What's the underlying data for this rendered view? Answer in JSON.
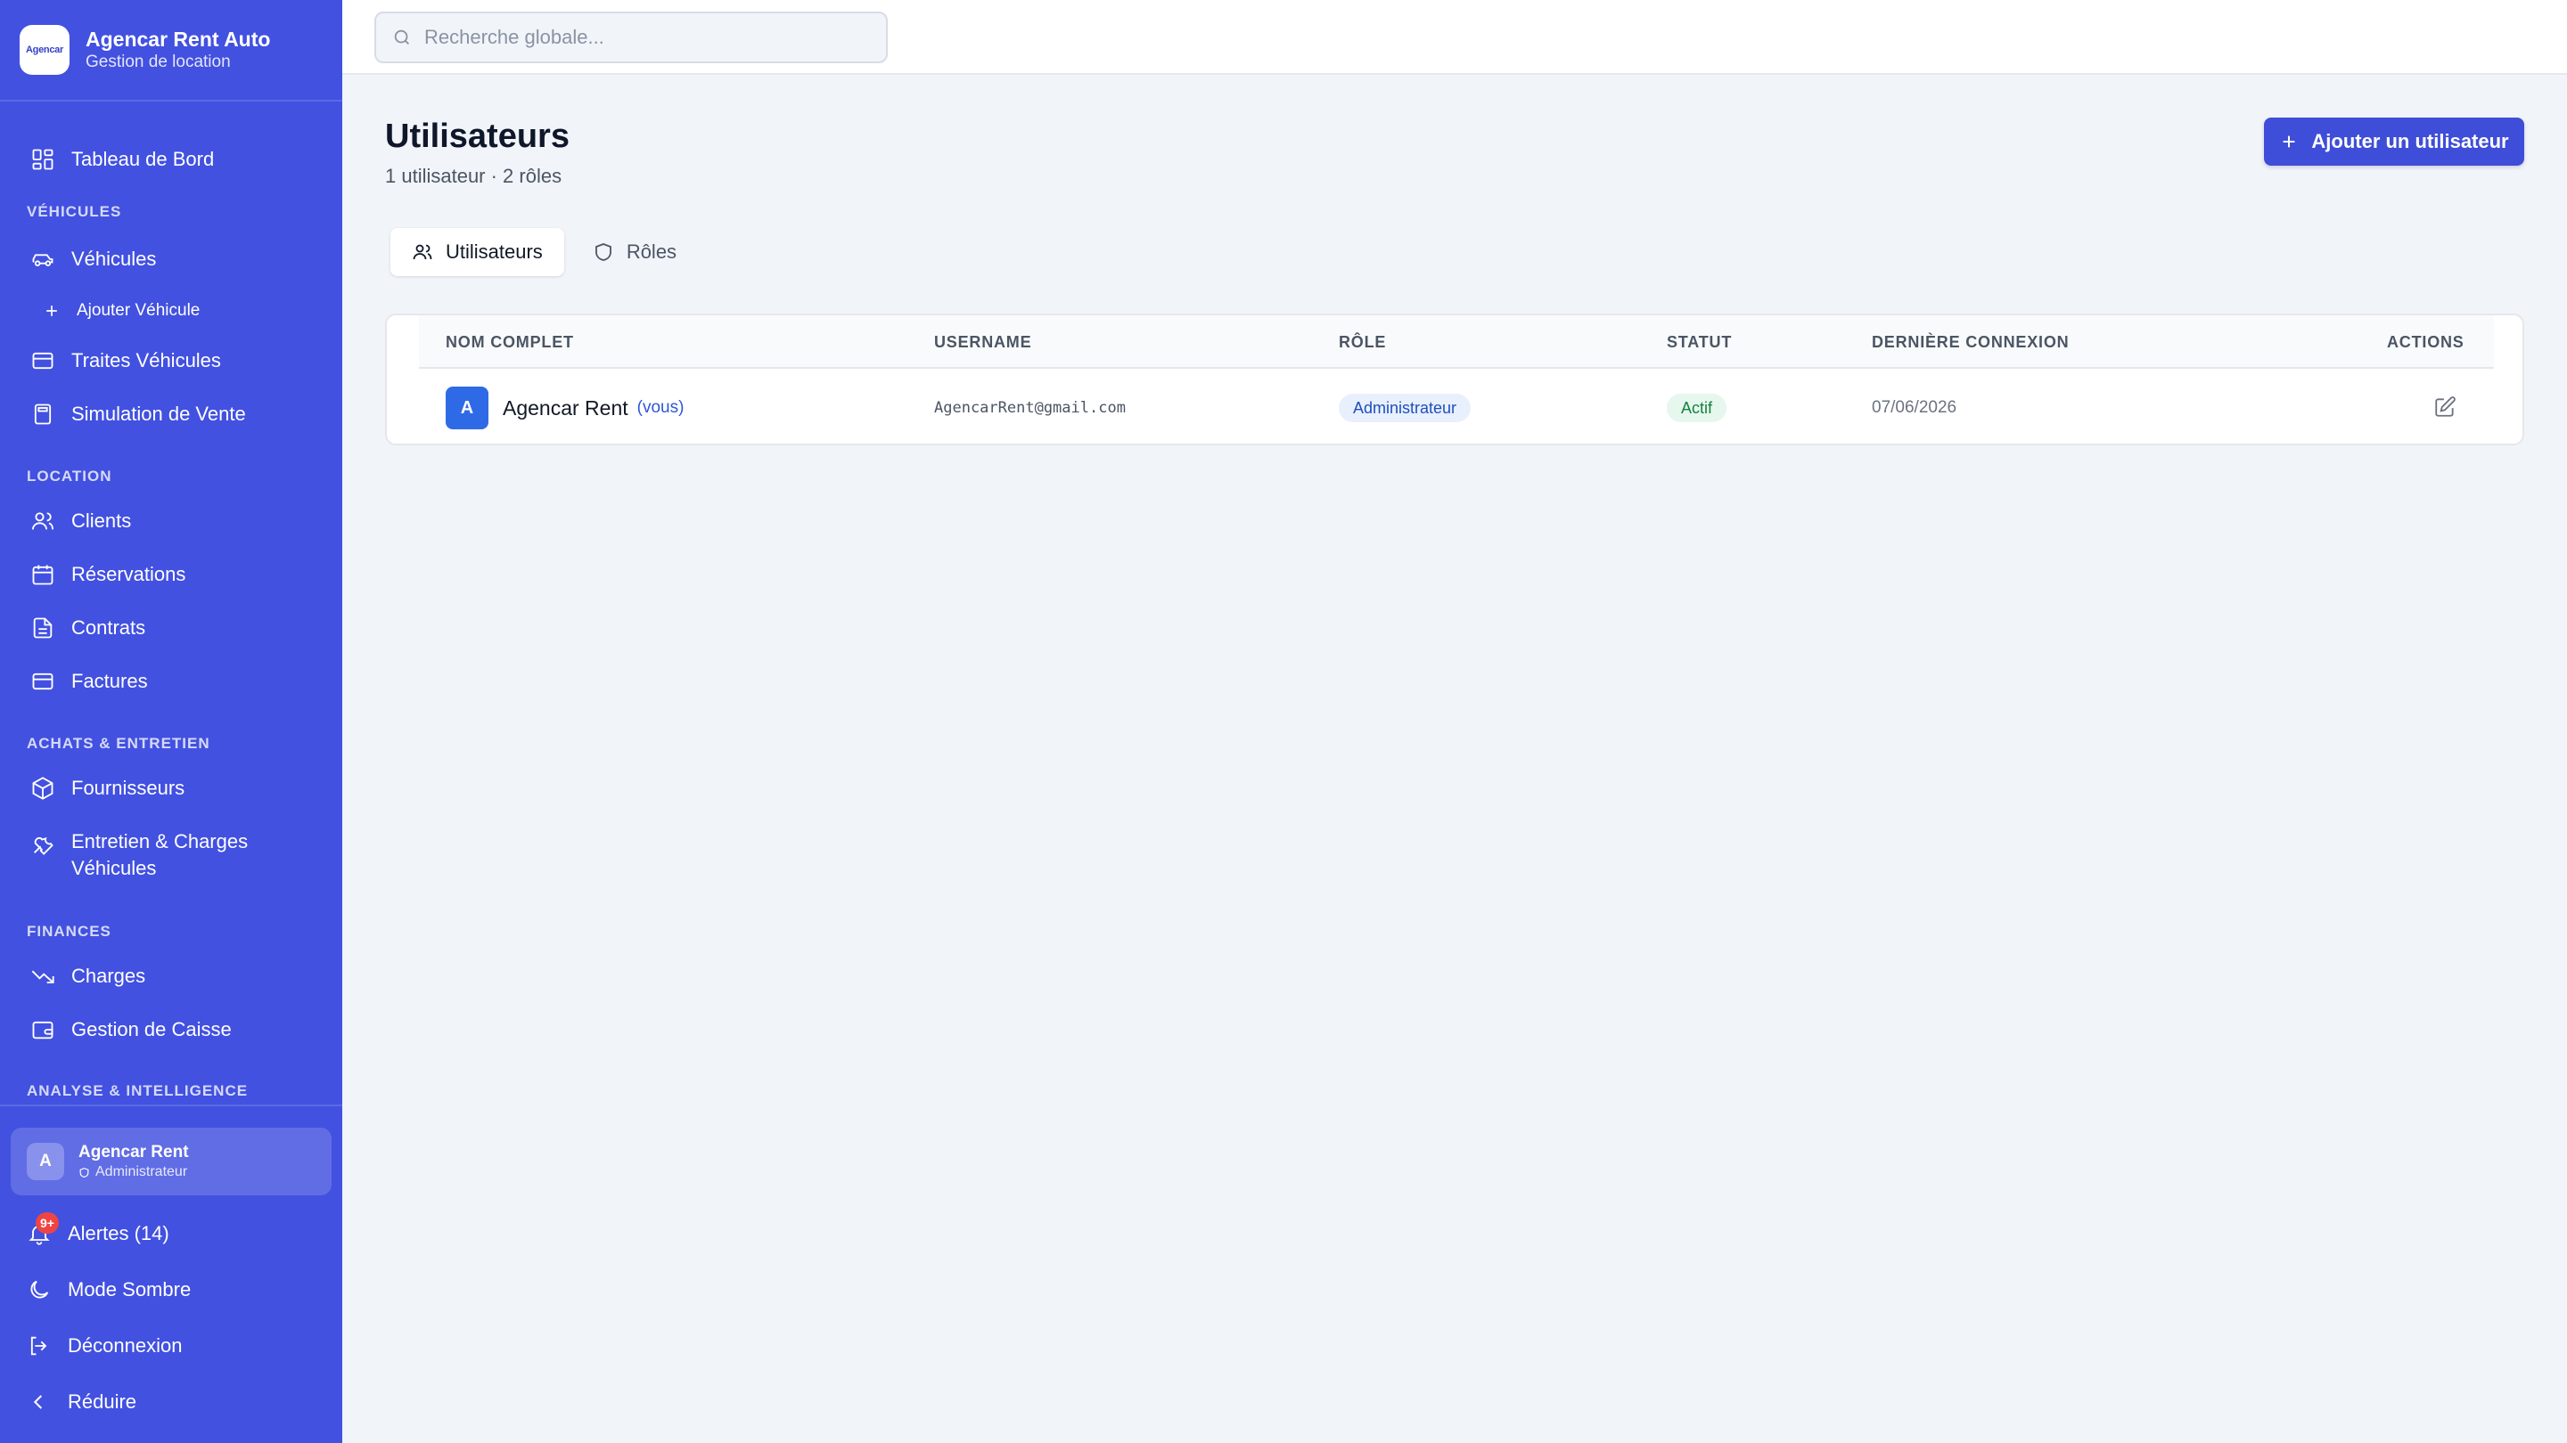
{
  "app": {
    "name": "Agencar Rent Auto",
    "subtitle": "Gestion de location",
    "logo_text": "Agencar"
  },
  "search": {
    "placeholder": "Recherche globale..."
  },
  "sidebar": {
    "dashboard": "Tableau de Bord",
    "sections": {
      "vehicules": "VÉHICULES",
      "location": "LOCATION",
      "achats": "ACHATS & ENTRETIEN",
      "finances": "FINANCES",
      "analyse": "ANALYSE & INTELLIGENCE"
    },
    "items": {
      "vehicules": "Véhicules",
      "ajouter_vehicule": "Ajouter Véhicule",
      "traites": "Traites Véhicules",
      "simulation": "Simulation de Vente",
      "clients": "Clients",
      "reservations": "Réservations",
      "contrats": "Contrats",
      "factures": "Factures",
      "fournisseurs": "Fournisseurs",
      "entretien_line1": "Entretien & Charges",
      "entretien_line2": "Véhicules",
      "charges": "Charges",
      "caisse": "Gestion de Caisse"
    },
    "user": {
      "initial": "A",
      "name": "Agencar Rent",
      "role": "Administrateur"
    },
    "bottom": {
      "alerts": "Alertes (14)",
      "alerts_badge": "9+",
      "dark_mode": "Mode Sombre",
      "logout": "Déconnexion",
      "collapse": "Réduire"
    }
  },
  "main": {
    "title": "Utilisateurs",
    "subtitle": "1 utilisateur · 2 rôles",
    "add_button": "Ajouter un utilisateur",
    "tabs": [
      {
        "label": "Utilisateurs",
        "active": true
      },
      {
        "label": "Rôles",
        "active": false
      }
    ],
    "table": {
      "headers": [
        "NOM COMPLET",
        "USERNAME",
        "RÔLE",
        "STATUT",
        "DERNIÈRE CONNEXION",
        "ACTIONS"
      ],
      "rows": [
        {
          "initial": "A",
          "name": "Agencar Rent",
          "you": "(vous)",
          "username": "AgencarRent@gmail.com",
          "role": "Administrateur",
          "status": "Actif",
          "last_login": "07/06/2026"
        }
      ]
    }
  },
  "colors": {
    "sidebar": "#4251e0",
    "primary": "#3e4ed8",
    "background": "#f1f4f9",
    "role_pill": "#e8f0fe",
    "status_pill": "#e6f7ee",
    "alert_badge": "#ef4444"
  }
}
